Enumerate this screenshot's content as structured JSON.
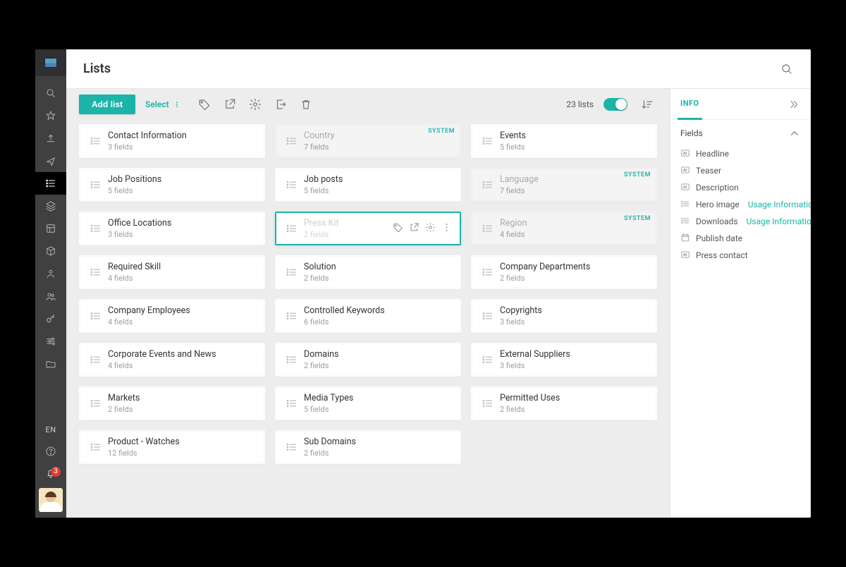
{
  "header": {
    "title": "Lists"
  },
  "sidebar": {
    "lang": "EN",
    "notifications": "3"
  },
  "toolbar": {
    "add_label": "Add list",
    "select_label": "Select",
    "count_text": "23 lists"
  },
  "panel": {
    "tab_info": "INFO",
    "section_title": "Fields",
    "usage_info": "Usage Information",
    "fields": [
      {
        "icon": "text",
        "name": "Headline"
      },
      {
        "icon": "text",
        "name": "Teaser"
      },
      {
        "icon": "text",
        "name": "Description"
      },
      {
        "icon": "image",
        "name": "Hero image",
        "extra": true
      },
      {
        "icon": "image",
        "name": "Downloads",
        "extra": true
      },
      {
        "icon": "date",
        "name": "Publish date"
      },
      {
        "icon": "text",
        "name": "Press contact"
      }
    ]
  },
  "lists": [
    {
      "title": "Contact Information",
      "sub": "3 fields"
    },
    {
      "title": "Country",
      "sub": "7 fields",
      "system": true,
      "muted": true
    },
    {
      "title": "Events",
      "sub": "5 fields"
    },
    {
      "title": "Job Positions",
      "sub": "5 fields"
    },
    {
      "title": "Job posts",
      "sub": "5 fields"
    },
    {
      "title": "Language",
      "sub": "7 fields",
      "system": true,
      "muted": true
    },
    {
      "title": "Office Locations",
      "sub": "3 fields"
    },
    {
      "title": "Press Kit",
      "sub": "2 fields",
      "selected": true
    },
    {
      "title": "Region",
      "sub": "4 fields",
      "system": true,
      "muted": true
    },
    {
      "title": "Required Skill",
      "sub": "4 fields"
    },
    {
      "title": "Solution",
      "sub": "2 fields"
    },
    {
      "title": "Company Departments",
      "sub": "2 fields"
    },
    {
      "title": "Company Employees",
      "sub": "4 fields"
    },
    {
      "title": "Controlled Keywords",
      "sub": "6 fields"
    },
    {
      "title": "Copyrights",
      "sub": "3 fields"
    },
    {
      "title": "Corporate Events and News",
      "sub": "4 fields"
    },
    {
      "title": "Domains",
      "sub": "2 fields"
    },
    {
      "title": "External Suppliers",
      "sub": "3 fields"
    },
    {
      "title": "Markets",
      "sub": "2 fields"
    },
    {
      "title": "Media Types",
      "sub": "5 fields"
    },
    {
      "title": "Permitted Uses",
      "sub": "2 fields"
    },
    {
      "title": "Product - Watches",
      "sub": "12 fields"
    },
    {
      "title": "Sub Domains",
      "sub": "2 fields"
    }
  ],
  "system_label": "SYSTEM"
}
